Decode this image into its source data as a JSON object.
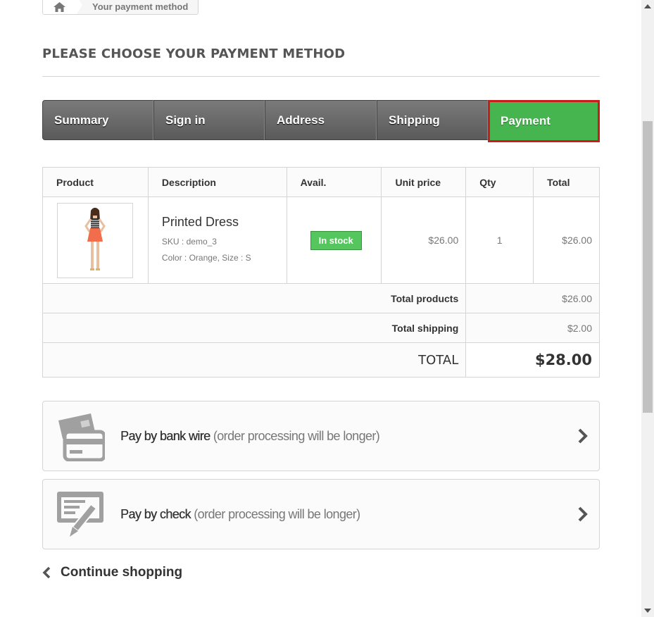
{
  "breadcrumb": {
    "home_icon": "home-icon",
    "current": "Your payment method"
  },
  "page_title": "PLEASE CHOOSE YOUR PAYMENT METHOD",
  "steps": [
    {
      "label": "Summary",
      "active": false
    },
    {
      "label": "Sign in",
      "active": false
    },
    {
      "label": "Address",
      "active": false
    },
    {
      "label": "Shipping",
      "active": false
    },
    {
      "label": "Payment",
      "active": true
    }
  ],
  "cart": {
    "headers": [
      "Product",
      "Description",
      "Avail.",
      "Unit price",
      "Qty",
      "Total"
    ],
    "items": [
      {
        "name": "Printed Dress",
        "sku": "SKU : demo_3",
        "attributes": "Color : Orange, Size : S",
        "availability": "In stock",
        "unit_price": "$26.00",
        "qty": "1",
        "total": "$26.00"
      }
    ],
    "total_products_label": "Total products",
    "total_products": "$26.00",
    "total_shipping_label": "Total shipping",
    "total_shipping": "$2.00",
    "total_label": "TOTAL",
    "total": "$28.00"
  },
  "payment_options": [
    {
      "main": "Pay by bank wire",
      "sub": "(order processing will be longer)",
      "icon": "bank-wire-card-icon"
    },
    {
      "main": "Pay by check",
      "sub": "(order processing will be longer)",
      "icon": "check-pen-icon"
    }
  ],
  "continue_shopping": "Continue shopping",
  "colors": {
    "accent_green": "#46b44f",
    "active_border": "#c71d1d",
    "step_gray": "#666666"
  }
}
